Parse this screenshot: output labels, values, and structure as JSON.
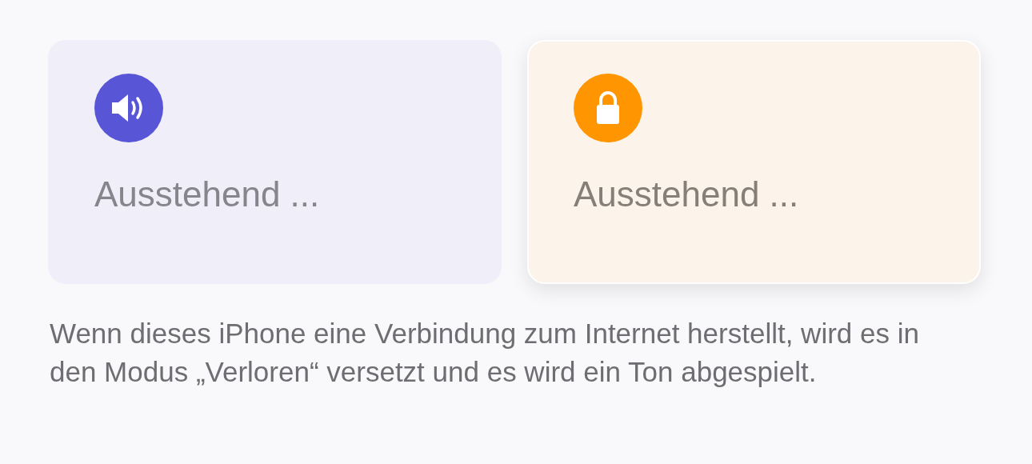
{
  "cards": [
    {
      "kind": "sound",
      "color": "#5856d6",
      "label": "Ausstehend ...",
      "selected": false
    },
    {
      "kind": "lock",
      "color": "#ff9500",
      "label": "Ausstehend ...",
      "selected": true
    }
  ],
  "description": "Wenn dieses iPhone eine Verbindung zum Internet herstellt, wird es in den Modus „Verloren“ versetzt und es wird ein Ton abgespielt."
}
